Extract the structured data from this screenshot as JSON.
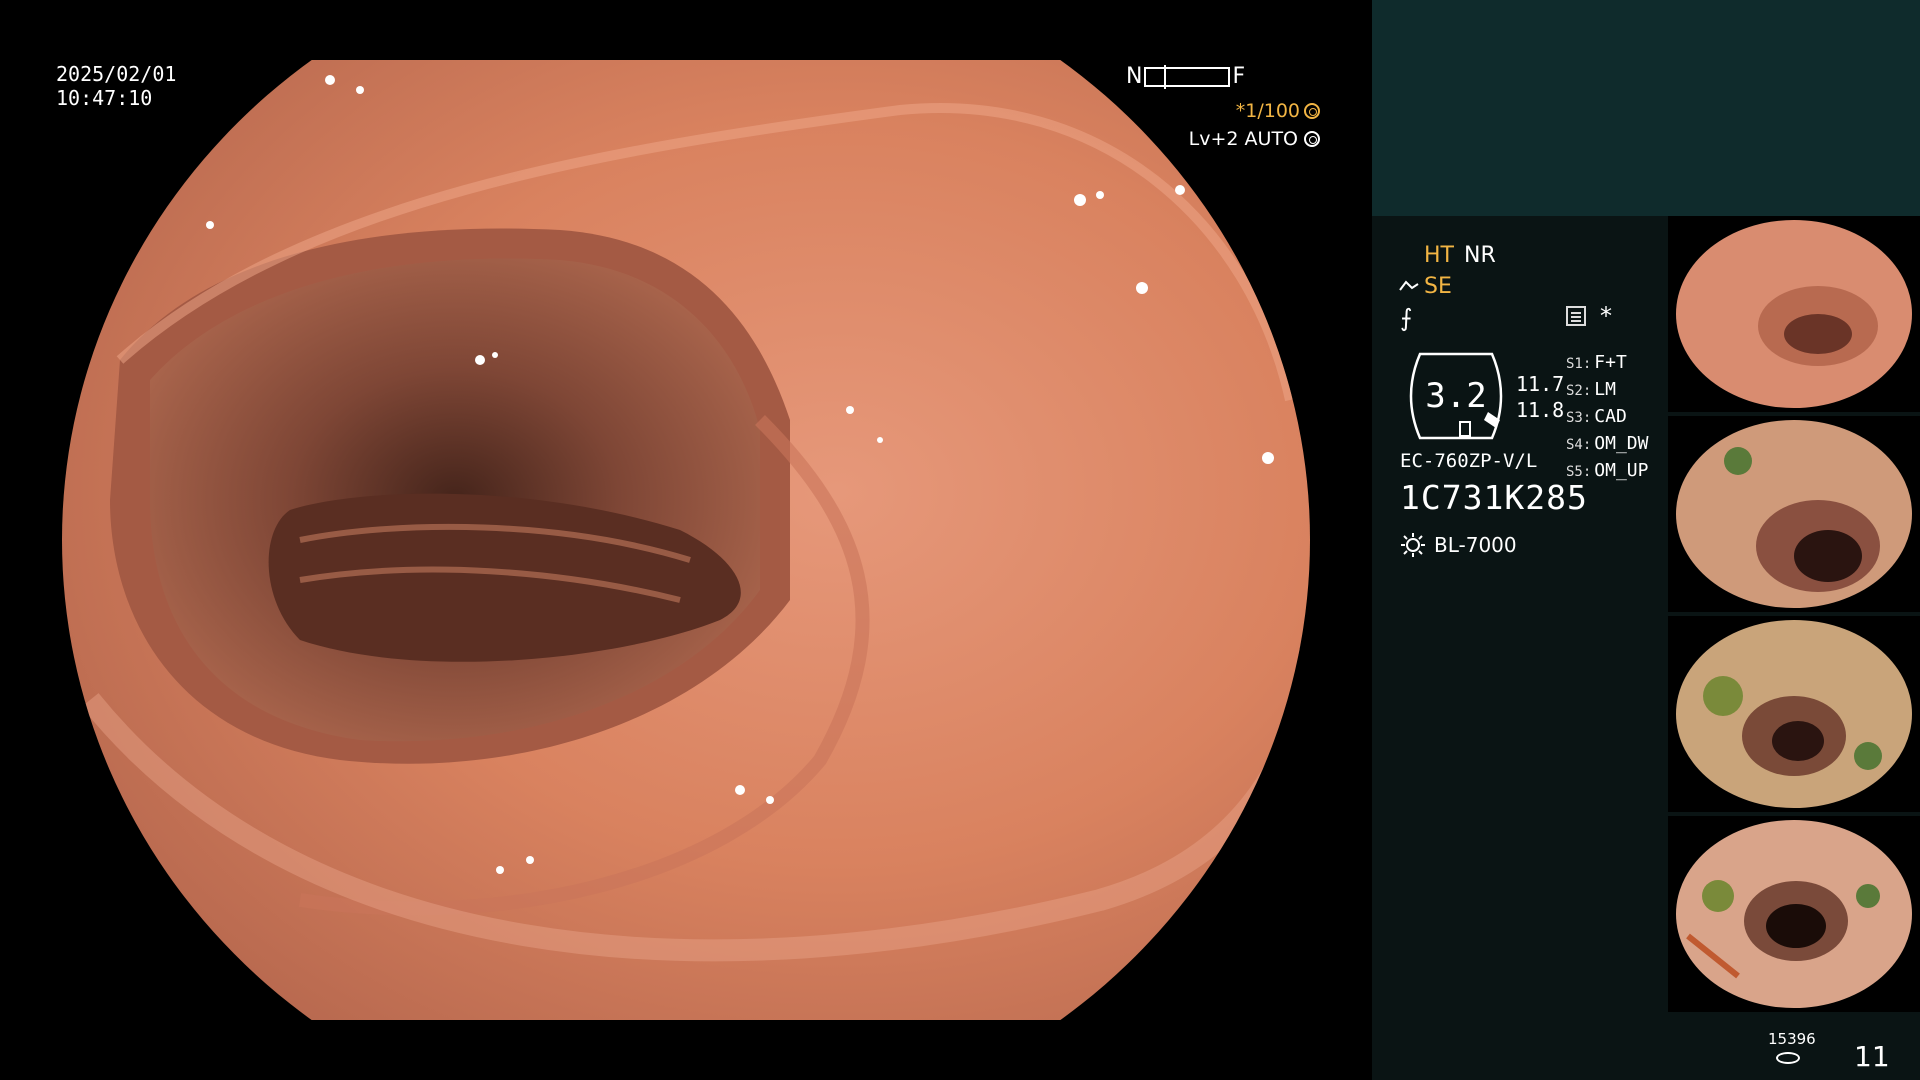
{
  "screen": {
    "date": "2025/02/01",
    "time": "10:47:10",
    "scope_nf": {
      "near": "N",
      "far": "F"
    },
    "shutter": "*1/100",
    "level": "Lv+2 AUTO"
  },
  "panel": {
    "mode_ht": "HT",
    "mode_nr": "NR",
    "mode_se": "SE",
    "star": "*",
    "gauge_value": "3.2",
    "sub_values": [
      "11.7",
      "11.8"
    ],
    "slots": [
      {
        "key": "S1:",
        "value": "F+T"
      },
      {
        "key": "S2:",
        "value": "LM"
      },
      {
        "key": "S3:",
        "value": "CAD"
      },
      {
        "key": "S4:",
        "value": "OM_DW"
      },
      {
        "key": "S5:",
        "value": "OM_UP"
      }
    ],
    "scope_model": "EC-760ZP-V/L",
    "serial": "1C731K285",
    "light_source": "BL-7000",
    "image_count_small": "15396",
    "image_count_big": "11"
  },
  "colors": {
    "accent": "#f2b544",
    "panel_top": "#0f2b2c",
    "panel_bg": "#0a1414",
    "mucosa": "#d88a6a"
  },
  "icons": [
    "scope-icon",
    "freeze-icon",
    "memo-icon",
    "light-source-icon",
    "disk-icon",
    "shutter-icon",
    "auto-icon"
  ]
}
